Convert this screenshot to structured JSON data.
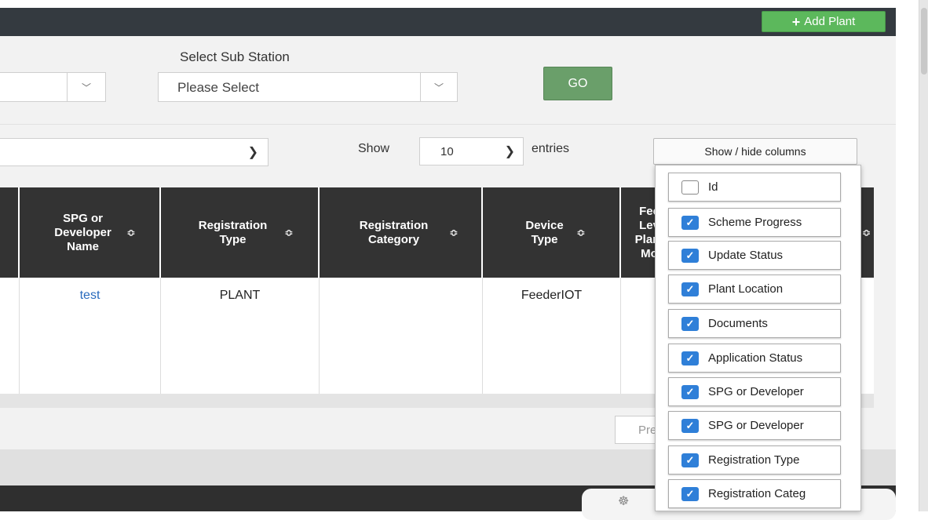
{
  "header": {
    "add_plant_label": "Add Plant"
  },
  "filters": {
    "sub_station_label": "Select Sub Station",
    "sub_station_value": "Please Select",
    "go_label": "GO"
  },
  "controls": {
    "show_label": "Show",
    "entries_value": "10",
    "entries_label": "entries",
    "show_hide_label": "Show / hide columns"
  },
  "table": {
    "headers": [
      {
        "label": "SPG or Developer Name"
      },
      {
        "label": "Registration Type"
      },
      {
        "label": "Registration Category"
      },
      {
        "label": "Device Type"
      },
      {
        "label": "Fee Lev Plant Mo"
      }
    ],
    "row": [
      "test",
      "PLANT",
      "",
      "FeederIOT"
    ]
  },
  "pager": {
    "prev_label": "Prev"
  },
  "column_menu": {
    "options": [
      {
        "label": "Id",
        "checked": false
      },
      {
        "label": "Scheme Progress",
        "checked": true
      },
      {
        "label": "Update Status",
        "checked": true
      },
      {
        "label": "Plant Location",
        "checked": true
      },
      {
        "label": "Documents",
        "checked": true
      },
      {
        "label": "Application Status",
        "checked": true
      },
      {
        "label": "SPG or Developer",
        "checked": true
      },
      {
        "label": "SPG or Developer",
        "checked": true
      },
      {
        "label": "Registration Type",
        "checked": true
      },
      {
        "label": "Registration Categ",
        "checked": true
      }
    ]
  }
}
